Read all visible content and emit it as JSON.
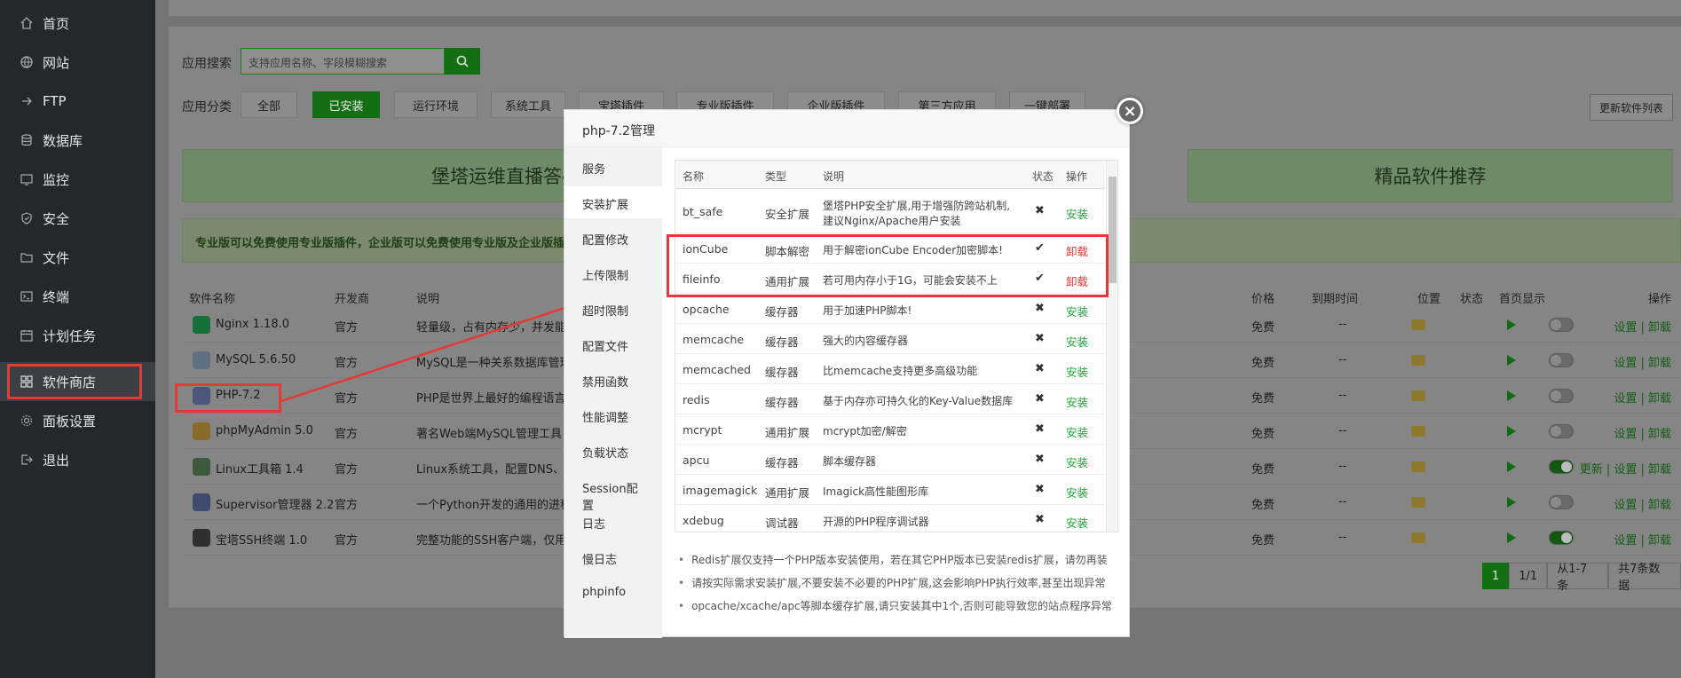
{
  "sidebar": {
    "items": [
      {
        "label": "首页",
        "icon": "home-icon"
      },
      {
        "label": "网站",
        "icon": "globe-icon"
      },
      {
        "label": "FTP",
        "icon": "ftp-icon"
      },
      {
        "label": "数据库",
        "icon": "database-icon"
      },
      {
        "label": "监控",
        "icon": "monitor-icon"
      },
      {
        "label": "安全",
        "icon": "shield-icon"
      },
      {
        "label": "文件",
        "icon": "folder-icon"
      },
      {
        "label": "终端",
        "icon": "terminal-icon"
      },
      {
        "label": "计划任务",
        "icon": "calendar-icon"
      },
      {
        "label": "软件商店",
        "icon": "grid-icon",
        "active": true
      },
      {
        "label": "面板设置",
        "icon": "gear-icon"
      },
      {
        "label": "退出",
        "icon": "logout-icon"
      }
    ]
  },
  "store": {
    "search_label": "应用搜索",
    "search_placeholder": "支持应用名称、字段模糊搜索",
    "category_label": "应用分类",
    "categories": [
      "全部",
      "已安装",
      "运行环境",
      "系统工具",
      "宝塔插件",
      "专业版插件",
      "企业版插件",
      "第三方应用",
      "一键部署"
    ],
    "active_category": "已安装",
    "update_button": "更新软件列表",
    "banner_left": "堡塔运维直播答疑",
    "banner_right": "精品软件推荐",
    "notice": "专业版可以免费使用专业版插件，企业版可以免费使用专业版及企业版插件",
    "columns": {
      "name": "软件名称",
      "dev": "开发商",
      "desc": "说明",
      "price": "价格",
      "expire": "到期时间",
      "location": "位置",
      "status": "状态",
      "home": "首页显示",
      "ops": "操作"
    },
    "rows": [
      {
        "name": "Nginx 1.18.0",
        "dev": "官方",
        "desc": "轻量级，占有内存少，并发能力",
        "price": "免费",
        "expire": "--",
        "home_on": false,
        "ops": "设置 | 卸载"
      },
      {
        "name": "MySQL 5.6.50",
        "dev": "官方",
        "desc": "MySQL是一种关系数据库管理系",
        "price": "免费",
        "expire": "--",
        "home_on": false,
        "ops": "设置 | 卸载"
      },
      {
        "name": "PHP-7.2",
        "dev": "官方",
        "desc": "PHP是世界上最好的编程语言",
        "price": "免费",
        "expire": "--",
        "home_on": false,
        "ops": "设置 | 卸载"
      },
      {
        "name": "phpMyAdmin 5.0",
        "dev": "官方",
        "desc": "著名Web端MySQL管理工具",
        "price": "免费",
        "expire": "--",
        "home_on": false,
        "ops": "设置 | 卸载"
      },
      {
        "name": "Linux工具箱 1.4",
        "dev": "官方",
        "desc": "Linux系统工具，配置DNS、Sw",
        "price": "免费",
        "expire": "--",
        "home_on": true,
        "ops": "更新 | 设置 | 卸载"
      },
      {
        "name": "Supervisor管理器 2.2",
        "dev": "官方",
        "desc": "一个Python开发的通用的进程管",
        "price": "免费",
        "expire": "--",
        "home_on": false,
        "ops": "设置 | 卸载"
      },
      {
        "name": "宝塔SSH终端 1.0",
        "dev": "官方",
        "desc": "完整功能的SSH客户端，仅用于",
        "price": "免费",
        "expire": "--",
        "home_on": true,
        "ops": "设置 | 卸载"
      }
    ],
    "pager": {
      "current": "1",
      "pages": "1/1",
      "range": "从1-7条",
      "total": "共7条数据"
    }
  },
  "modal": {
    "title": "php-7.2管理",
    "tabs": [
      "服务",
      "安装扩展",
      "配置修改",
      "上传限制",
      "超时限制",
      "配置文件",
      "禁用函数",
      "性能调整",
      "负载状态",
      "Session配置",
      "日志",
      "慢日志",
      "phpinfo"
    ],
    "active_tab": "安装扩展",
    "columns": {
      "name": "名称",
      "type": "类型",
      "desc": "说明",
      "status": "状态",
      "action": "操作"
    },
    "extensions": [
      {
        "name": "bt_safe",
        "type": "安全扩展",
        "desc": "堡塔PHP安全扩展,用于增强防跨站机制,",
        "desc2": "建议Nginx/Apache用户安装",
        "status": "✖",
        "action": "安装"
      },
      {
        "name": "ionCube",
        "type": "脚本解密",
        "desc": "用于解密ionCube Encoder加密脚本!",
        "status": "✔",
        "action": "卸载"
      },
      {
        "name": "fileinfo",
        "type": "通用扩展",
        "desc": "若可用内存小于1G，可能会安装不上",
        "status": "✔",
        "action": "卸载"
      },
      {
        "name": "opcache",
        "type": "缓存器",
        "desc": "用于加速PHP脚本!",
        "status": "✖",
        "action": "安装"
      },
      {
        "name": "memcache",
        "type": "缓存器",
        "desc": "强大的内容缓存器",
        "status": "✖",
        "action": "安装"
      },
      {
        "name": "memcached",
        "type": "缓存器",
        "desc": "比memcache支持更多高级功能",
        "status": "✖",
        "action": "安装"
      },
      {
        "name": "redis",
        "type": "缓存器",
        "desc": "基于内存亦可持久化的Key-Value数据库",
        "status": "✖",
        "action": "安装"
      },
      {
        "name": "mcrypt",
        "type": "通用扩展",
        "desc": "mcrypt加密/解密",
        "status": "✖",
        "action": "安装"
      },
      {
        "name": "apcu",
        "type": "缓存器",
        "desc": "脚本缓存器",
        "status": "✖",
        "action": "安装"
      },
      {
        "name": "imagemagick",
        "type": "通用扩展",
        "desc": "Imagick高性能图形库",
        "status": "✖",
        "action": "安装"
      },
      {
        "name": "xdebug",
        "type": "调试器",
        "desc": "开源的PHP程序调试器",
        "status": "✖",
        "action": "安装"
      }
    ],
    "tips": [
      "Redis扩展仅支持一个PHP版本安装使用，若在其它PHP版本已安装redis扩展，请勿再装",
      "请按实际需求安装扩展,不要安装不必要的PHP扩展,这会影响PHP执行效率,甚至出现异常",
      "opcache/xcache/apc等脚本缓存扩展,请只安装其中1个,否则可能导致您的站点程序异常"
    ],
    "close_glyph": "×"
  },
  "colors": {
    "accent": "#20a53a",
    "danger": "#e53935",
    "sidebar_bg": "#23272e"
  }
}
